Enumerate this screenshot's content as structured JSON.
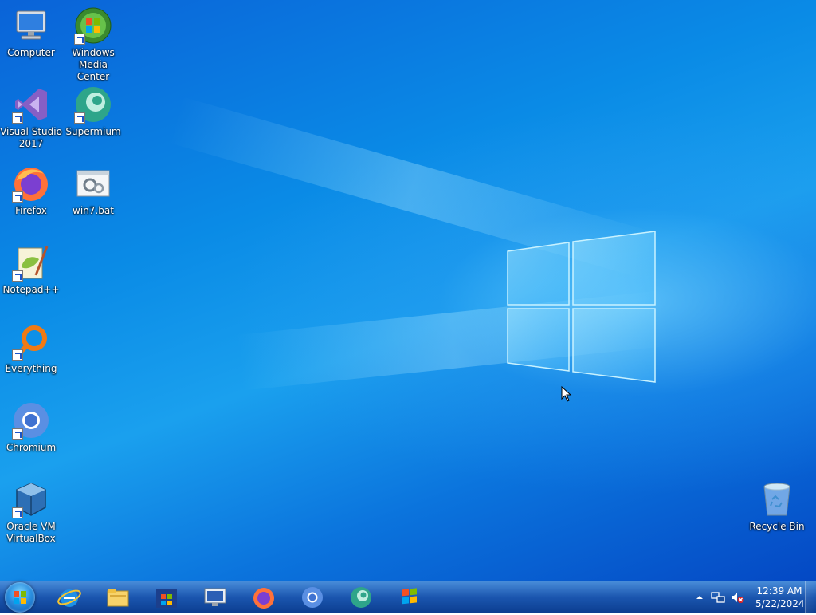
{
  "desktop": {
    "icons": [
      {
        "label": "Computer",
        "icon": "computer-icon",
        "shortcut": false
      },
      {
        "label": "Windows Media Center",
        "icon": "windows-media-center-icon",
        "shortcut": true
      },
      {
        "label": "Visual Studio 2017",
        "icon": "visual-studio-icon",
        "shortcut": true
      },
      {
        "label": "Supermium",
        "icon": "supermium-icon",
        "shortcut": true
      },
      {
        "label": "Firefox",
        "icon": "firefox-icon",
        "shortcut": true
      },
      {
        "label": "win7.bat",
        "icon": "batch-file-icon",
        "shortcut": false
      },
      {
        "label": "Notepad++",
        "icon": "notepad-plus-plus-icon",
        "shortcut": true
      },
      {
        "label": "Everything",
        "icon": "everything-search-icon",
        "shortcut": true
      },
      {
        "label": "Chromium",
        "icon": "chromium-icon",
        "shortcut": true
      },
      {
        "label": "Oracle VM VirtualBox",
        "icon": "virtualbox-icon",
        "shortcut": true
      },
      {
        "label": "Recycle Bin",
        "icon": "recycle-bin-icon",
        "shortcut": false
      }
    ]
  },
  "taskbar": {
    "start": "windows-start-orb",
    "pinned": [
      "internet-explorer-icon",
      "file-explorer-icon",
      "microsoft-store-icon",
      "remote-desktop-icon",
      "firefox-icon",
      "chromium-icon",
      "supermium-icon",
      "windows-media-center-icon"
    ],
    "tray": {
      "icons": [
        "show-hidden-icons-arrow",
        "network-icon",
        "volume-muted-icon"
      ],
      "time": "12:39 AM",
      "date": "5/22/2024"
    }
  },
  "colors": {
    "wallpaper": "#0a8be6",
    "taskbar": "#0e4caa",
    "logo_glow": "#7fd8ff"
  }
}
